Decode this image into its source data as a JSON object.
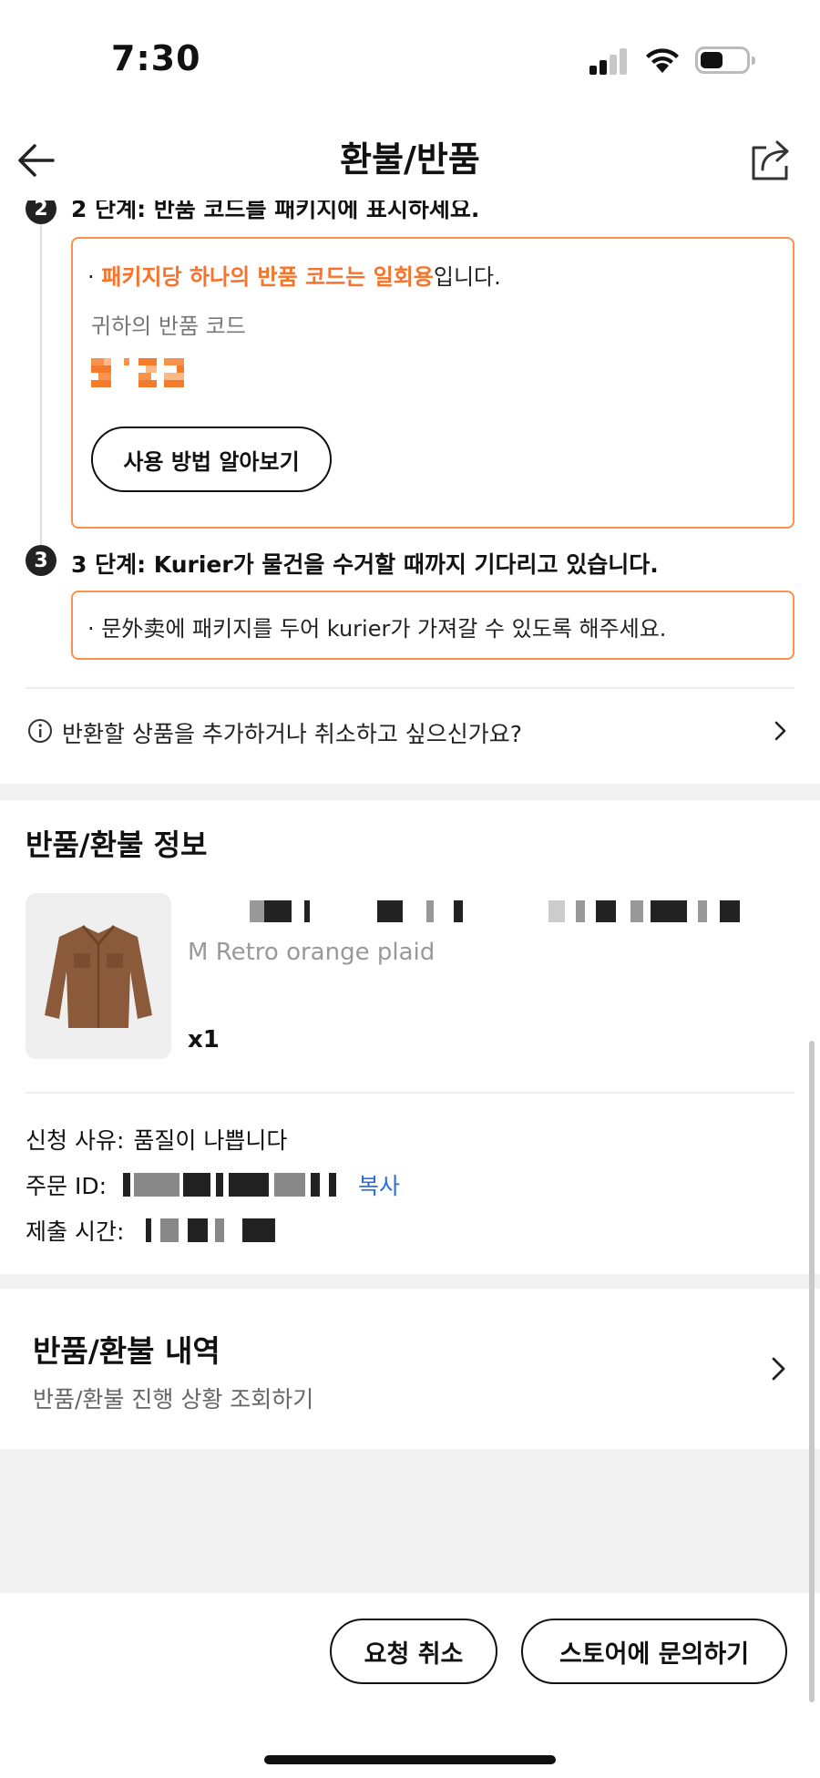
{
  "status_bar": {
    "time": "7:30"
  },
  "header": {
    "title": "환불/반품"
  },
  "steps": [
    {
      "number": "2",
      "title": "2 단계: 반품 코드를 패키지에 표시하세요."
    },
    {
      "number": "3",
      "title": "3 단계: Kurier가 물건을 수거할 때까지 기다리고 있습니다."
    }
  ],
  "step2_box": {
    "bullet_prefix": "· ",
    "bullet_highlight": "패키지당 하나의 반품 코드는 일회용",
    "bullet_suffix": "입니다.",
    "code_label": "귀하의 반품 코드",
    "howto_button": "사용 방법 알아보기"
  },
  "step3_box": {
    "bullet": "· 문外卖에 패키지를 두어 kurier가 가져갈 수 있도록 해주세요."
  },
  "question": {
    "text": "반환할 상품을 추가하거나 취소하고 싶으신가요?"
  },
  "return_info": {
    "title": "반품/환불 정보",
    "variant": "M Retro orange plaid",
    "quantity": "x1",
    "reason_label": "신청 사유:",
    "reason_value": "품질이 나쁩니다",
    "order_id_label": "주문 ID:",
    "copy_label": "복사",
    "submit_time_label": "제출 시간:"
  },
  "history": {
    "title": "반품/환불 내역",
    "subtitle": "반품/환불 진행 상황 조회하기"
  },
  "actions": {
    "cancel_request": "요청 취소",
    "contact_store": "스토어에 문의하기"
  },
  "colors": {
    "accent_orange": "#f7722a",
    "box_border": "#f7934c",
    "link_blue": "#2a6fe0"
  }
}
